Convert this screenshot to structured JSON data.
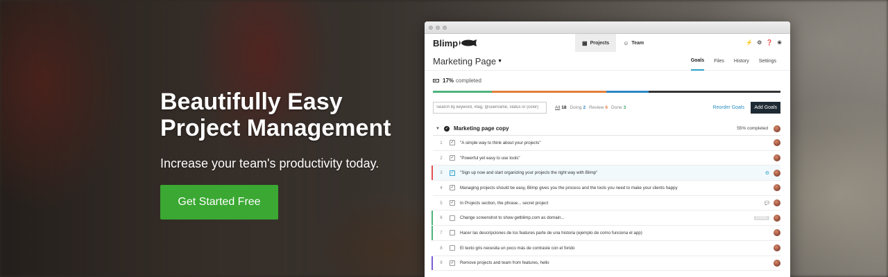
{
  "hero": {
    "title_line1": "Beautifully Easy",
    "title_line2": "Project Management",
    "subtitle": "Increase your team's productivity today.",
    "cta_label": "Get Started Free"
  },
  "app": {
    "brand": "Blimp",
    "nav": [
      {
        "label": "Projects",
        "icon": "projects-icon"
      },
      {
        "label": "Team",
        "icon": "team-icon"
      }
    ],
    "top_icons": [
      "bolt-icon",
      "gear-icon",
      "help-icon",
      "bug-icon"
    ],
    "page_title": "Marketing Page",
    "subtabs": [
      "Goals",
      "Files",
      "History",
      "Settings"
    ],
    "progress": {
      "percent_label": "17%",
      "suffix": "completed"
    },
    "progress_segments": [
      {
        "color": "#4bb37b",
        "fraction": 0.17
      },
      {
        "color": "#e37d3a",
        "fraction": 0.33
      },
      {
        "color": "#2a86c4",
        "fraction": 0.12
      },
      {
        "color": "#333333",
        "fraction": 0.38
      }
    ],
    "search_placeholder": "Search by keyword, #tag, @username, status or (color)",
    "filters": {
      "all_label": "All",
      "all_count": "18",
      "doing_label": "Doing",
      "doing_count": "2",
      "review_label": "Review",
      "review_count": "6",
      "done_label": "Done",
      "done_count": "3"
    },
    "reorder_label": "Reorder Goals",
    "add_label": "Add Goals",
    "group": {
      "title": "Marketing page copy",
      "completed": "55% completed"
    },
    "rows": [
      {
        "num": "1",
        "text": "\"A simple way to think about your projects\"",
        "checked": true
      },
      {
        "num": "2",
        "text": "\"Powerful yet easy to use tools\"",
        "checked": true
      },
      {
        "num": "3",
        "text": "\"Sign up now and start organizing your projects the right way with Blimp\"",
        "checked": true
      },
      {
        "num": "4",
        "text": "Managing projects should be easy, Blimp gives you the process and the tools you need to make your clients happy",
        "checked": true
      },
      {
        "num": "5",
        "text": "In Projects section, the phrase... secret project",
        "checked": true
      },
      {
        "num": "6",
        "text": "Change screenshot to show getblimp.com as domain...",
        "checked": false,
        "tag": "DOING"
      },
      {
        "num": "7",
        "text": "Hacer las descripciones de los features parte de una historia (ejemplo de como funciona el app)",
        "checked": false
      },
      {
        "num": "8",
        "text": "El texto gris necesita un poco más de contraste con el fondo",
        "checked": false
      },
      {
        "num": "9",
        "text": "Remove projects and team from features, hello",
        "checked": true
      }
    ]
  }
}
